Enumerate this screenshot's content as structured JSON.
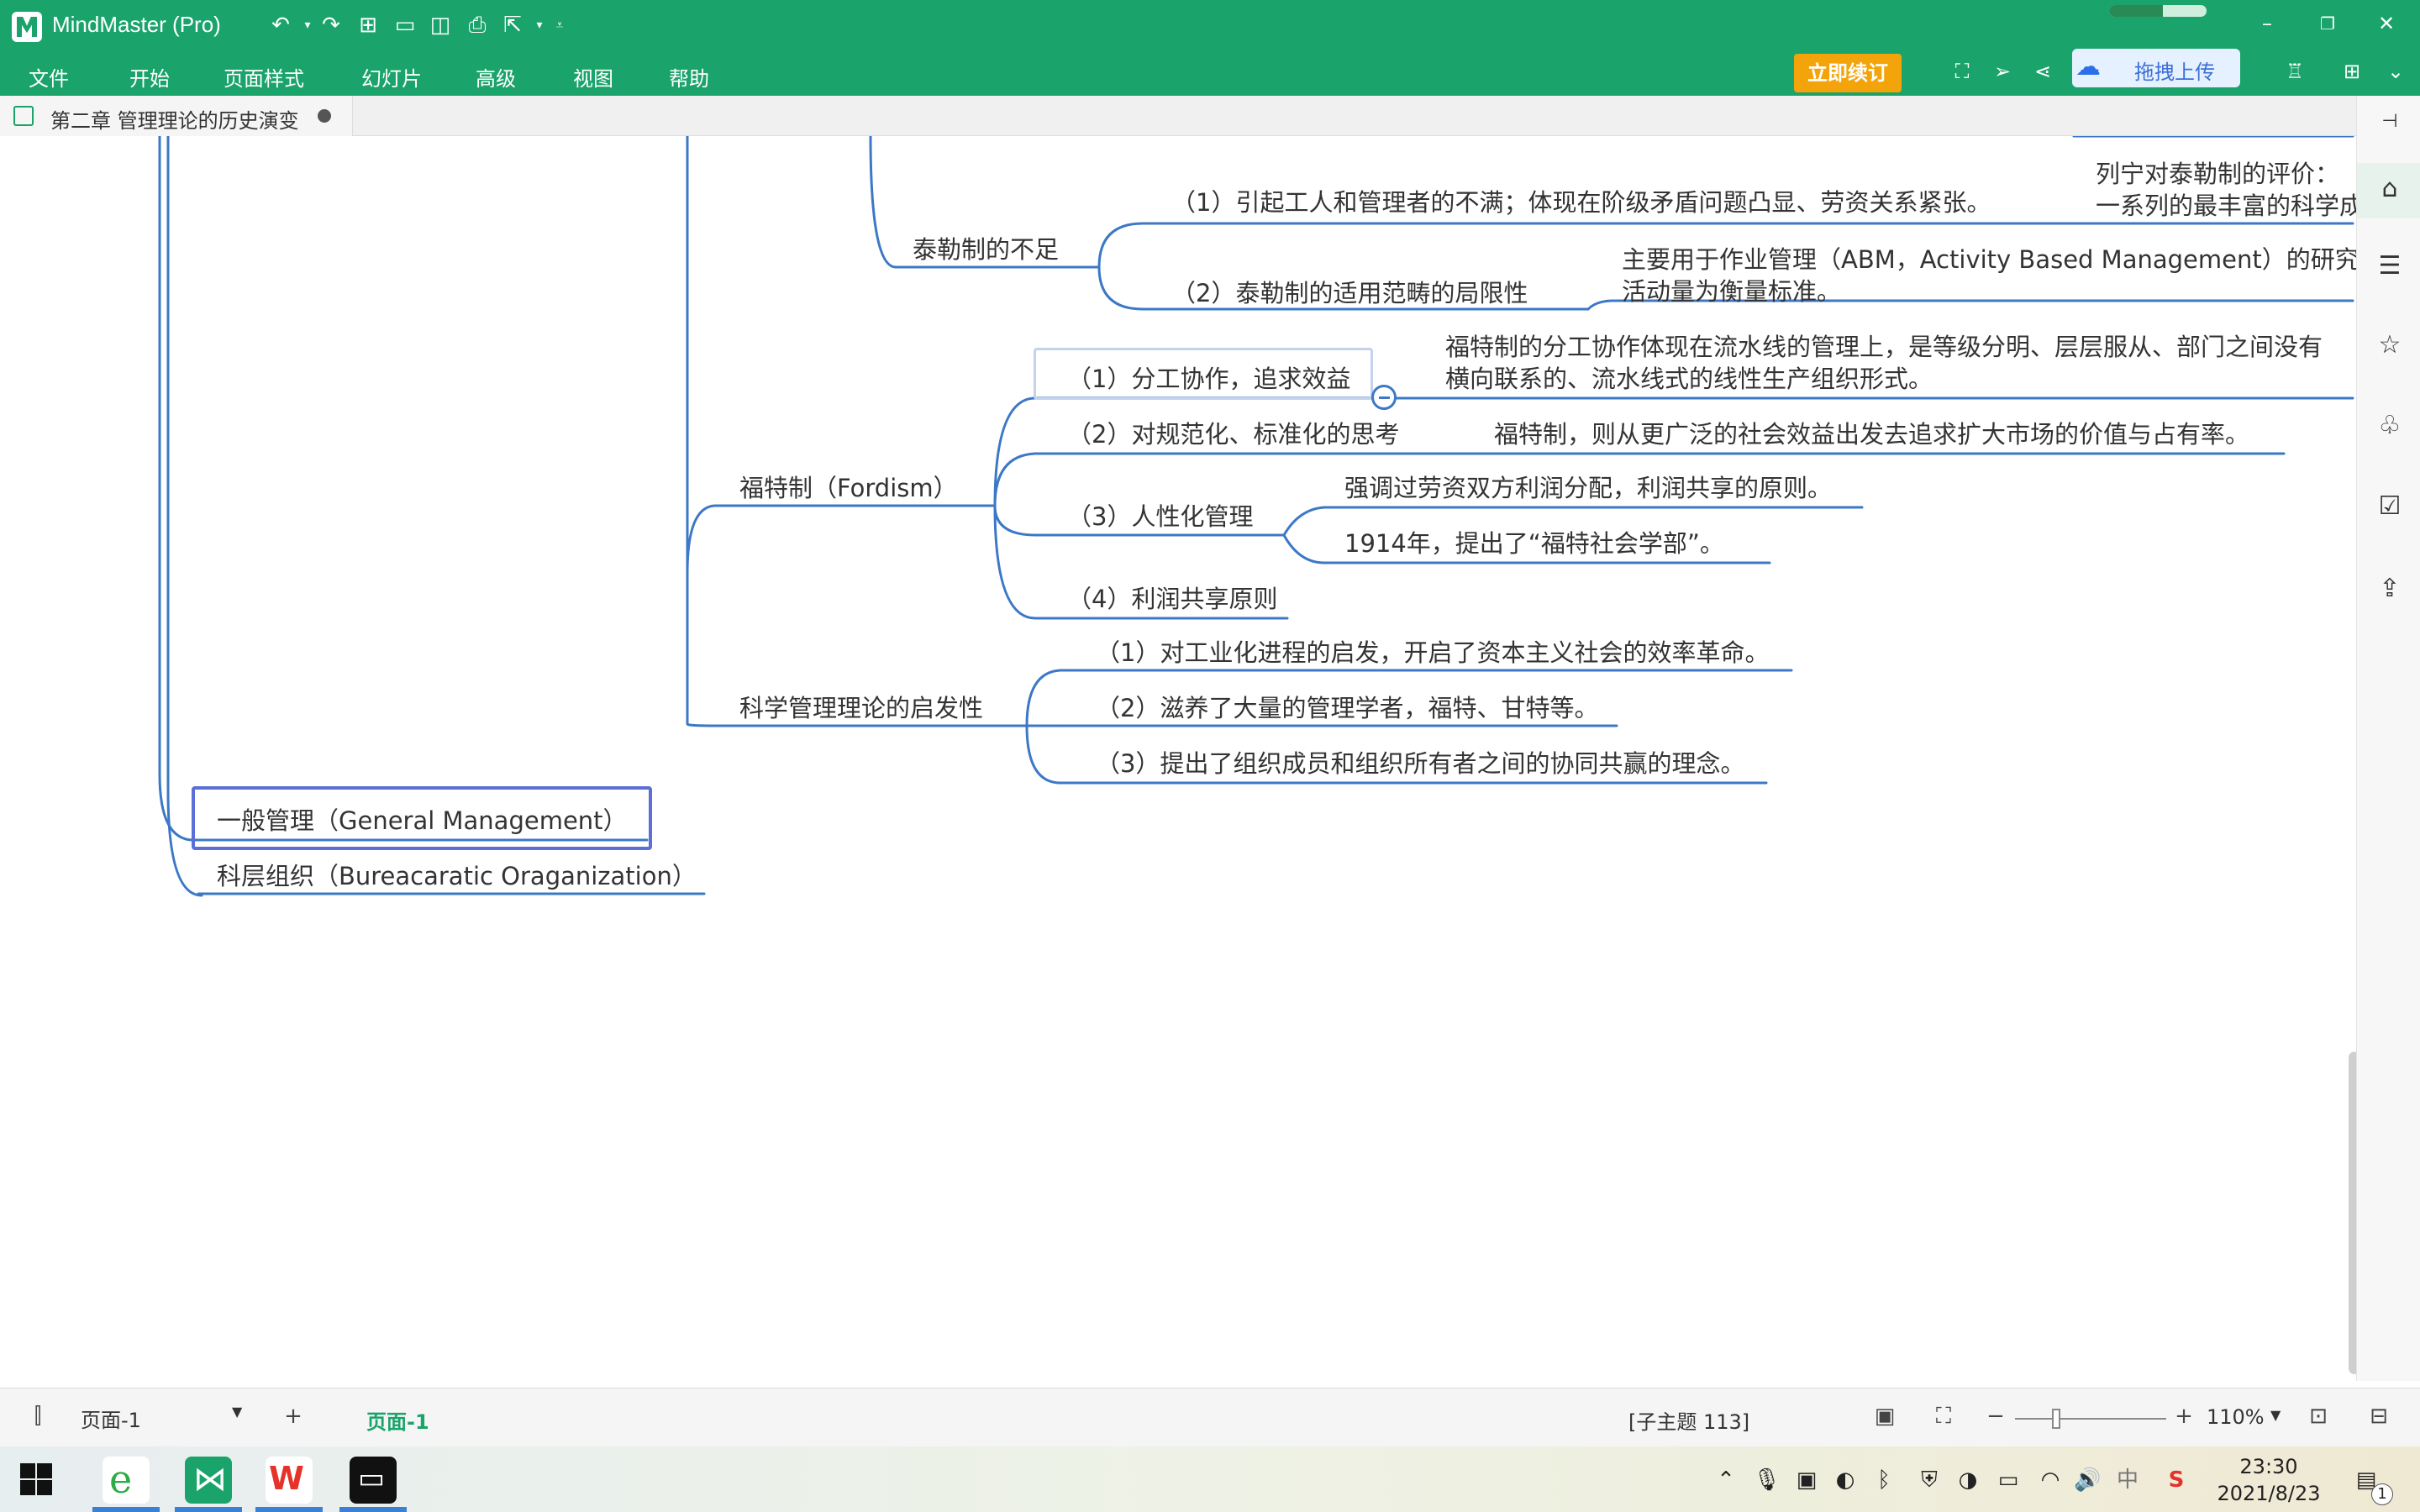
{
  "app": {
    "title": "MindMaster (Pro)",
    "progress": 0.55
  },
  "menu": [
    "文件",
    "开始",
    "页面样式",
    "幻灯片",
    "高级",
    "视图",
    "帮助"
  ],
  "toolbar": {
    "renew_label": "立即续订",
    "upload_label": "拖拽上传"
  },
  "document_tab": {
    "title": "第二章 管理理论的历史演变"
  },
  "mindmap": {
    "taylor_shortcomings": {
      "label": "泰勒制的不足",
      "children": [
        {
          "label": "（1）引起工人和管理者的不满；体现在阶级矛盾问题凸显、劳资关系紧张。"
        },
        {
          "label": "（2）泰勒制的适用范畴的局限性",
          "note_line1": "主要用于作业管理（ABM，Activity Based Management）的研究",
          "note_line2": "活动量为衡量标准。"
        }
      ],
      "lenin_line1": "列宁对泰勒制的评价：",
      "lenin_line2": "一系列的最丰富的科学成"
    },
    "fordism": {
      "label": "福特制（Fordism）",
      "children": [
        {
          "label": "（1）分工协作，追求效益",
          "note_line1": "福特制的分工协作体现在流水线的管理上，是等级分明、层层服从、部门之间没有",
          "note_line2": "横向联系的、流水线式的线性生产组织形式。"
        },
        {
          "label": "（2）对规范化、标准化的思考",
          "note": "福特制，则从更广泛的社会效益出发去追求扩大市场的价值与占有率。"
        },
        {
          "label": "（3）人性化管理",
          "subs": [
            "强调过劳资双方利润分配，利润共享的原则。",
            "1914年，提出了“福特社会学部”。"
          ]
        },
        {
          "label": "（4）利润共享原则"
        }
      ]
    },
    "inspiration": {
      "label": "科学管理理论的启发性",
      "children": [
        "（1）对工业化进程的启发，开启了资本主义社会的效率革命。",
        "（2）滋养了大量的管理学者，福特、甘特等。",
        "（3）提出了组织成员和组织所有者之间的协同共赢的理念。"
      ]
    },
    "general_management": "一般管理（General Management）",
    "bureaucratic": "科层组织（Bureacaratic Oraganization）"
  },
  "statusbar": {
    "page_select": "页面-1",
    "page_tab": "页面-1",
    "subtopic_count": "[子主题 113]",
    "zoom": "110%",
    "zoom_level": 0.27
  },
  "taskbar": {
    "time": "23:30",
    "date": "2021/8/23",
    "ime": "中",
    "notification_count": "1"
  },
  "colors": {
    "brand_green": "#1aa36a",
    "branch_blue": "#3c78c6",
    "selection": "#5b6fd6",
    "renew_orange": "#f4a40b"
  }
}
